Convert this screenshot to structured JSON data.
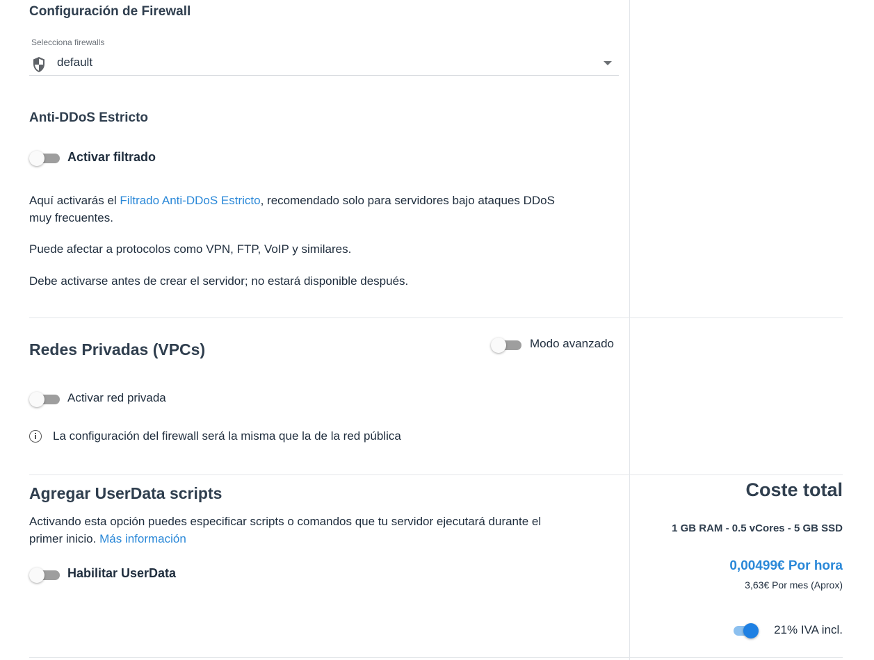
{
  "firewall": {
    "title": "Configuración de Firewall",
    "select_label": "Selecciona firewalls",
    "selected_value": "default"
  },
  "antiddos": {
    "title": "Anti-DDoS Estricto",
    "toggle_label": "Activar filtrado",
    "toggle_on": false,
    "desc_prefix": "Aquí activarás el ",
    "desc_link": "Filtrado Anti-DDoS Estricto",
    "desc_suffix_line1": ", recomendado solo para servidores bajo ataques DDoS",
    "desc_line2": "muy frecuentes.",
    "note1": "Puede afectar a protocolos como VPN, FTP, VoIP y similares.",
    "note2": "Debe activarse antes de crear el servidor; no estará disponible después."
  },
  "vpc": {
    "title": "Redes Privadas (VPCs)",
    "advanced_label": "Modo avanzado",
    "advanced_on": false,
    "private_label": "Activar red privada",
    "private_on": false,
    "info_text": "La configuración del firewall será la misma que la de la red pública"
  },
  "userdata": {
    "title": "Agregar UserData scripts",
    "desc_line1": "Activando esta opción puedes especificar scripts o comandos que tu servidor ejecutará durante el",
    "desc_line2_prefix": "primer inicio. ",
    "desc_link": "Más información",
    "toggle_label": "Habilitar UserData",
    "toggle_on": false
  },
  "summary": {
    "title": "Coste total",
    "specs": "1 GB RAM - 0.5 vCores - 5 GB SSD",
    "price_hour": "0,00499€ Por hora",
    "price_month": "3,63€ Por mes (Aprox)",
    "vat_label": "21% IVA incl.",
    "vat_on": true,
    "accent_color": "#2a88d8"
  }
}
